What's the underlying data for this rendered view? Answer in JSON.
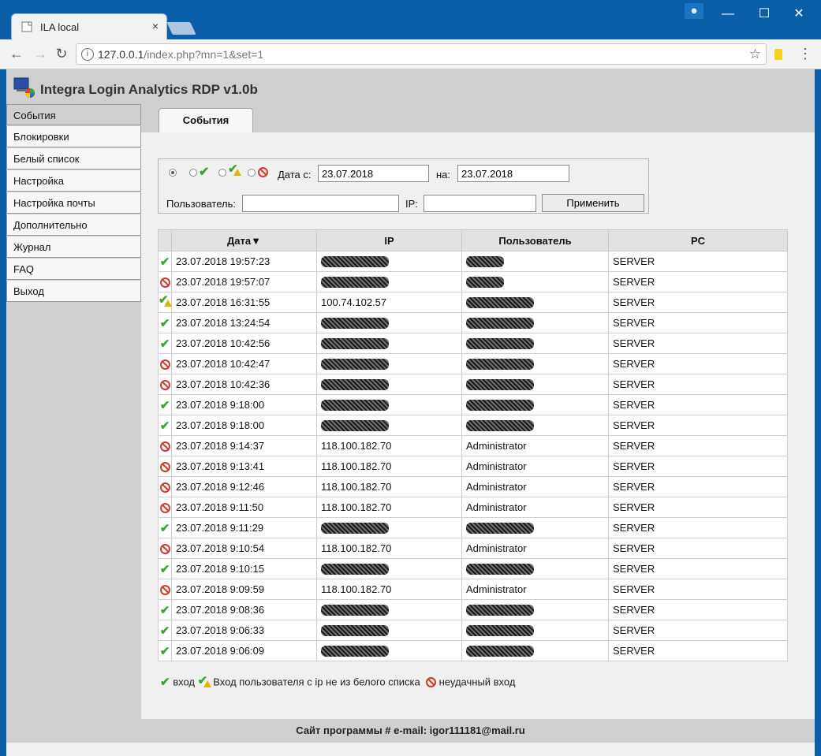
{
  "browser": {
    "tab_title": "ILA local",
    "tab_close": "×",
    "url_host": "127.0.0.1",
    "url_path": "/index.php?mn=1&set=1",
    "window_min": "—",
    "window_max": "☐",
    "window_close": "✕"
  },
  "app": {
    "title": "Integra Login Analytics RDP v1.0b"
  },
  "sidebar": {
    "items": [
      {
        "label": "События"
      },
      {
        "label": "Блокировки"
      },
      {
        "label": "Белый список"
      },
      {
        "label": "Настройка"
      },
      {
        "label": "Настройка почты"
      },
      {
        "label": "Дополнительно"
      },
      {
        "label": "Журнал"
      },
      {
        "label": "FAQ"
      },
      {
        "label": "Выход"
      }
    ]
  },
  "content": {
    "tab_label": "События"
  },
  "filter": {
    "date_from_label": "Дата с:",
    "date_from_value": "23.07.2018",
    "date_to_label": "на:",
    "date_to_value": "23.07.2018",
    "user_label": "Пользователь:",
    "user_value": "",
    "ip_label": "IP:",
    "ip_value": "",
    "apply_label": "Применить",
    "selected_radio": "all"
  },
  "table": {
    "headers": {
      "date": "Дата▼",
      "ip": "IP",
      "user": "Пользователь",
      "pc": "PC"
    },
    "rows": [
      {
        "status": "ok",
        "date": "23.07.2018 19:57:23",
        "ip": "",
        "user": "",
        "pc": "SERVER"
      },
      {
        "status": "fail",
        "date": "23.07.2018 19:57:07",
        "ip": "",
        "user": "",
        "pc": "SERVER"
      },
      {
        "status": "warn",
        "date": "23.07.2018 16:31:55",
        "ip": "100.74.102.57",
        "user": "",
        "pc": "SERVER"
      },
      {
        "status": "ok",
        "date": "23.07.2018 13:24:54",
        "ip": "",
        "user": "",
        "pc": "SERVER"
      },
      {
        "status": "ok",
        "date": "23.07.2018 10:42:56",
        "ip": "",
        "user": "",
        "pc": "SERVER"
      },
      {
        "status": "fail",
        "date": "23.07.2018 10:42:47",
        "ip": "",
        "user": "",
        "pc": "SERVER"
      },
      {
        "status": "fail",
        "date": "23.07.2018 10:42:36",
        "ip": "",
        "user": "",
        "pc": "SERVER"
      },
      {
        "status": "ok",
        "date": "23.07.2018 9:18:00",
        "ip": "",
        "user": "",
        "pc": "SERVER"
      },
      {
        "status": "ok",
        "date": "23.07.2018 9:18:00",
        "ip": "",
        "user": "",
        "pc": "SERVER"
      },
      {
        "status": "fail",
        "date": "23.07.2018 9:14:37",
        "ip": "118.100.182.70",
        "user": "Administrator",
        "pc": "SERVER"
      },
      {
        "status": "fail",
        "date": "23.07.2018 9:13:41",
        "ip": "118.100.182.70",
        "user": "Administrator",
        "pc": "SERVER"
      },
      {
        "status": "fail",
        "date": "23.07.2018 9:12:46",
        "ip": "118.100.182.70",
        "user": "Administrator",
        "pc": "SERVER"
      },
      {
        "status": "fail",
        "date": "23.07.2018 9:11:50",
        "ip": "118.100.182.70",
        "user": "Administrator",
        "pc": "SERVER"
      },
      {
        "status": "ok",
        "date": "23.07.2018 9:11:29",
        "ip": "",
        "user": "",
        "pc": "SERVER"
      },
      {
        "status": "fail",
        "date": "23.07.2018 9:10:54",
        "ip": "118.100.182.70",
        "user": "Administrator",
        "pc": "SERVER"
      },
      {
        "status": "ok",
        "date": "23.07.2018 9:10:15",
        "ip": "",
        "user": "",
        "pc": "SERVER"
      },
      {
        "status": "fail",
        "date": "23.07.2018 9:09:59",
        "ip": "118.100.182.70",
        "user": "Administrator",
        "pc": "SERVER"
      },
      {
        "status": "ok",
        "date": "23.07.2018 9:08:36",
        "ip": "",
        "user": "",
        "pc": "SERVER"
      },
      {
        "status": "ok",
        "date": "23.07.2018 9:06:33",
        "ip": "",
        "user": "",
        "pc": "SERVER"
      },
      {
        "status": "ok",
        "date": "23.07.2018 9:06:09",
        "ip": "",
        "user": "",
        "pc": "SERVER"
      }
    ]
  },
  "legend": {
    "ok_label": "вход",
    "warn_label": "Вход пользователя с ip не из белого списка",
    "fail_label": "неудачный вход"
  },
  "footer": {
    "text": "Сайт программы # e-mail: igor111181@mail.ru"
  },
  "colors": {
    "chrome_blue": "#0b5fa8",
    "ok_green": "#3aa33a",
    "fail_red": "#d23b2b",
    "warn_yellow": "#e2b400"
  }
}
